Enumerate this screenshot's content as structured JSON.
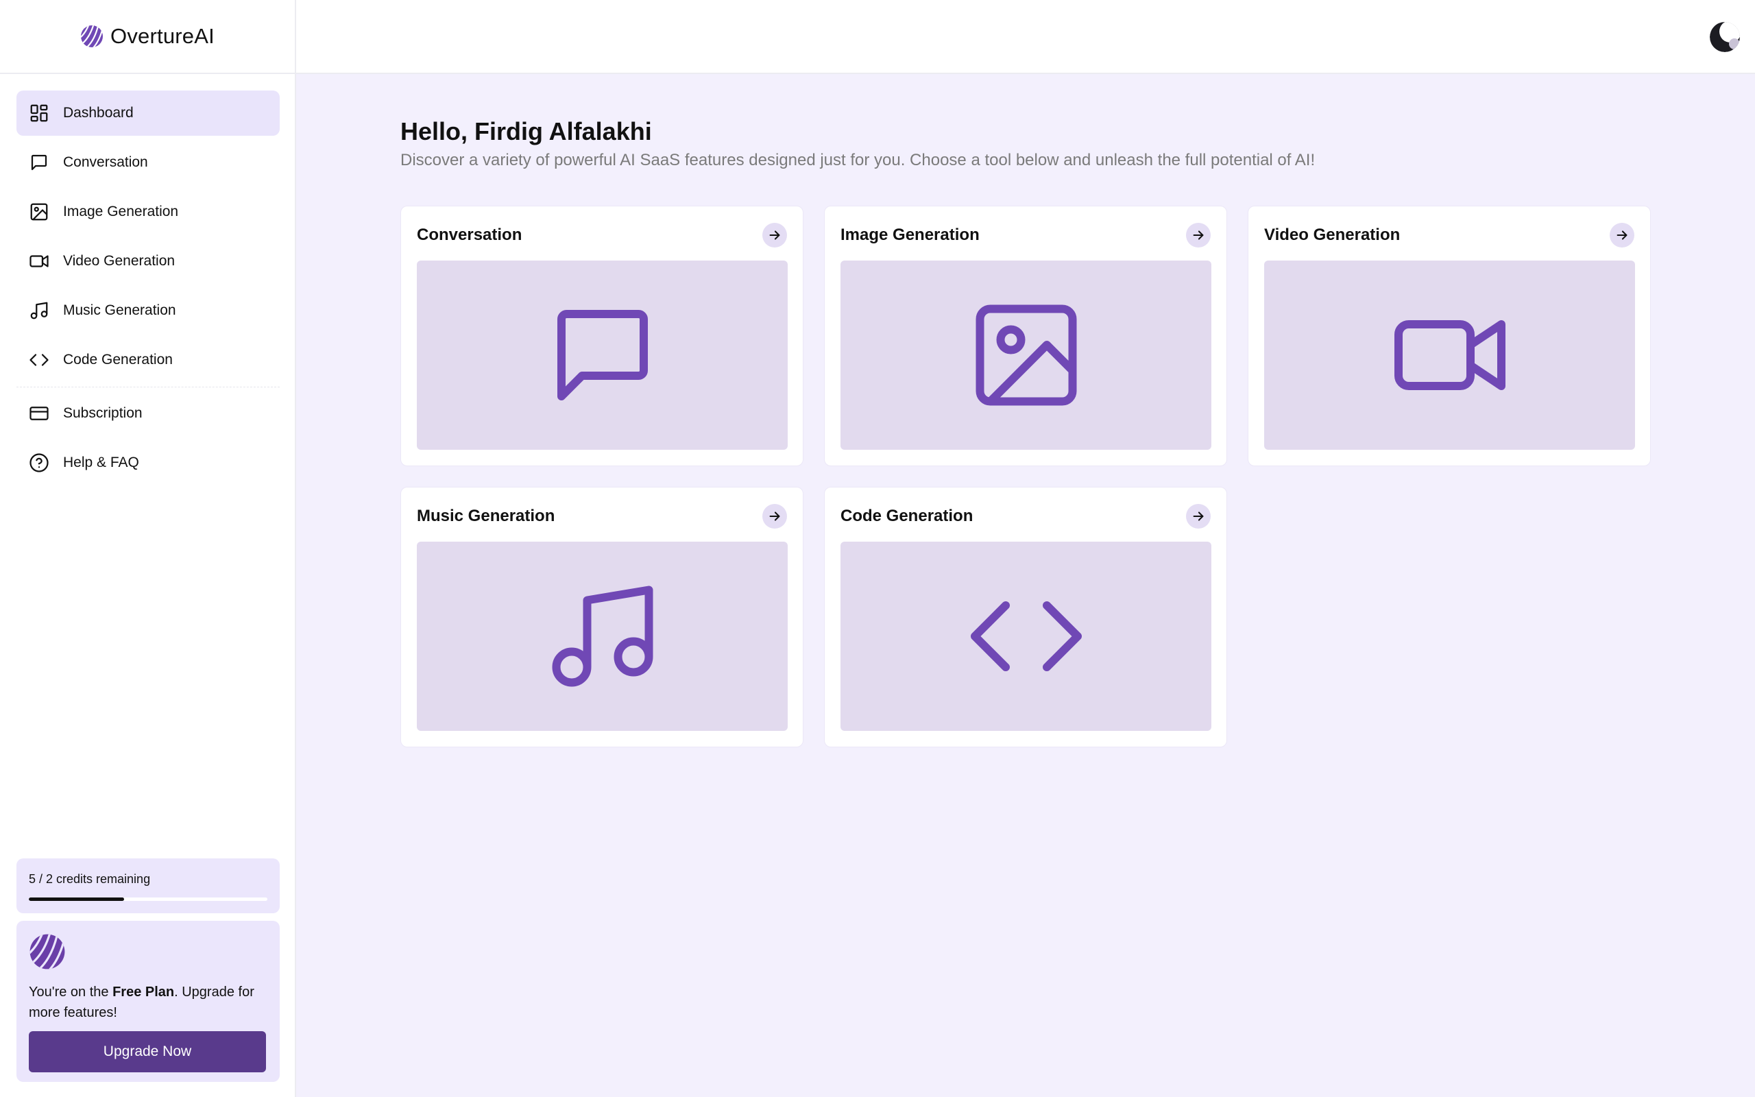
{
  "app": {
    "name": "OvertureAI"
  },
  "sidebar": {
    "items": [
      {
        "label": "Dashboard",
        "icon": "dashboard-icon"
      },
      {
        "label": "Conversation",
        "icon": "chat-bubble-icon"
      },
      {
        "label": "Image Generation",
        "icon": "image-icon"
      },
      {
        "label": "Video Generation",
        "icon": "video-camera-icon"
      },
      {
        "label": "Music Generation",
        "icon": "music-note-icon"
      },
      {
        "label": "Code Generation",
        "icon": "code-brackets-icon"
      },
      {
        "label": "Subscription",
        "icon": "credit-card-icon"
      },
      {
        "label": "Help & FAQ",
        "icon": "help-circle-icon"
      }
    ],
    "active": "Dashboard"
  },
  "credits": {
    "text": "5 / 2 credits remaining",
    "progress_percent": 40
  },
  "plan": {
    "prefix": "You're on the ",
    "plan_name": "Free Plan",
    "suffix": ". Upgrade for more features!",
    "button_label": "Upgrade Now"
  },
  "main": {
    "greeting": "Hello, Firdig Alfalakhi",
    "subtitle": "Discover a variety of powerful AI SaaS features designed just for you. Choose a tool below and unleash the full potential of AI!",
    "cards": [
      {
        "title": "Conversation",
        "icon": "chat-bubble-icon"
      },
      {
        "title": "Image Generation",
        "icon": "image-icon"
      },
      {
        "title": "Video Generation",
        "icon": "video-camera-icon"
      },
      {
        "title": "Music Generation",
        "icon": "music-note-icon"
      },
      {
        "title": "Code Generation",
        "icon": "code-brackets-icon"
      }
    ]
  },
  "colors": {
    "accent": "#7048b5",
    "button": "#593a8c",
    "active_nav_bg": "#e9e4fb",
    "main_bg": "#f3f0fd",
    "card_media_bg": "#e2daee"
  }
}
